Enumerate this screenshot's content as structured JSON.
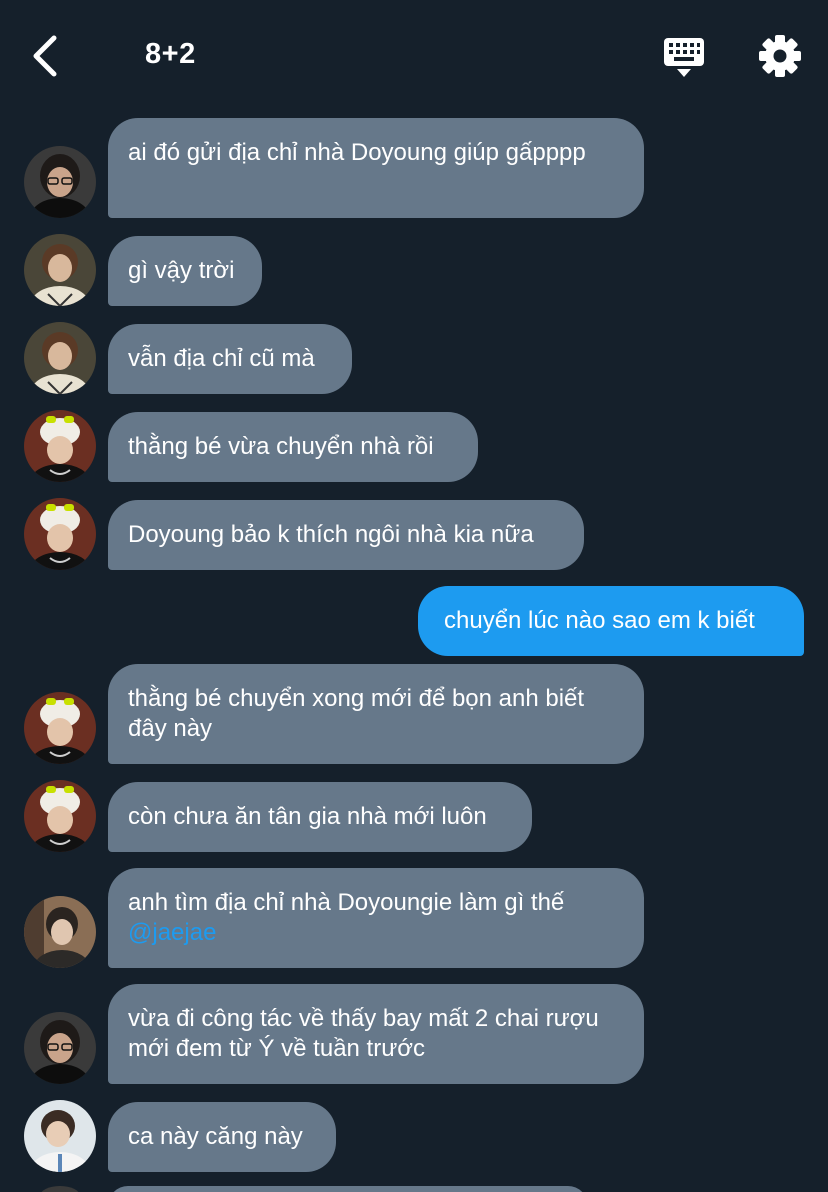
{
  "header": {
    "title": "8+2",
    "back_icon": "chevron-left-icon",
    "keyboard_icon": "keyboard-icon",
    "settings_icon": "gear-icon"
  },
  "colors": {
    "background": "#15202b",
    "incoming_bubble": "#66788a",
    "outgoing_bubble": "#1d9bf0",
    "mention": "#1d9bf0"
  },
  "messages": [
    {
      "direction": "in",
      "avatar": "avatar-a",
      "text": "ai đó gửi địa chỉ nhà Doyoung giúp gấpppp"
    },
    {
      "direction": "in",
      "avatar": "avatar-b",
      "text": "gì vậy trời"
    },
    {
      "direction": "in",
      "avatar": "avatar-b",
      "text": "vẫn địa chỉ cũ mà"
    },
    {
      "direction": "in",
      "avatar": "avatar-c",
      "text": "thằng bé vừa chuyển nhà rồi"
    },
    {
      "direction": "in",
      "avatar": "avatar-c",
      "text": "Doyoung bảo k thích ngôi nhà kia nữa"
    },
    {
      "direction": "out",
      "text": "chuyển lúc nào sao em k biết"
    },
    {
      "direction": "in",
      "avatar": "avatar-c",
      "text": "thằng bé chuyển xong mới để bọn anh biết đây này"
    },
    {
      "direction": "in",
      "avatar": "avatar-c",
      "text": "còn chưa ăn tân gia nhà mới luôn"
    },
    {
      "direction": "in",
      "avatar": "avatar-d",
      "text": "anh tìm địa chỉ nhà Doyoungie làm gì thế",
      "mention": "@jaejae"
    },
    {
      "direction": "in",
      "avatar": "avatar-a",
      "text": "vừa đi công tác về thấy bay mất 2 chai rượu mới đem từ Ý về tuần trước"
    },
    {
      "direction": "in",
      "avatar": "avatar-e",
      "text": "ca này căng này"
    }
  ]
}
